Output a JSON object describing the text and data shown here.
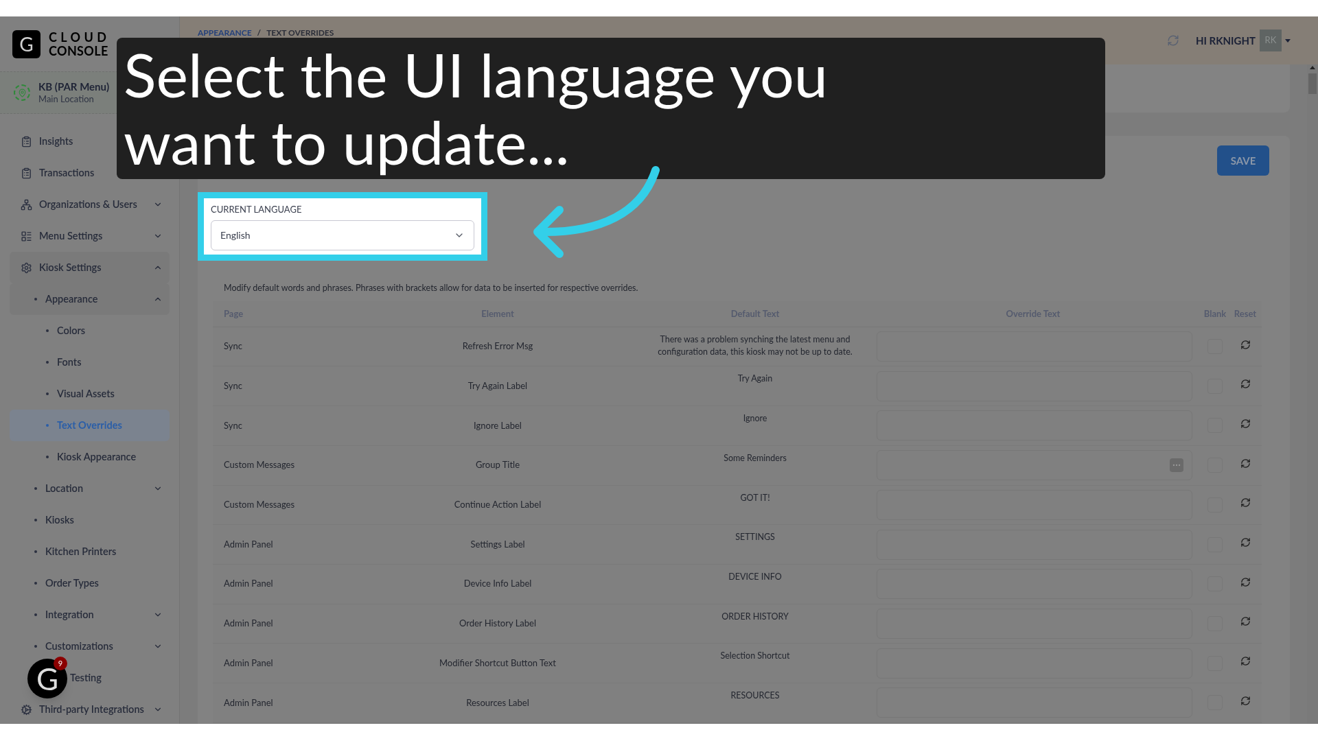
{
  "tutorial": {
    "caption": "Select the UI language you want to update..."
  },
  "brand": {
    "mark": "G",
    "line1": "CLOUD",
    "line2": "CONSOLE"
  },
  "location": {
    "name": "KB (PAR Menu)",
    "subtitle": "Main Location"
  },
  "sidebar": {
    "items": [
      {
        "label": "Insights",
        "kind": "link",
        "selected": false
      },
      {
        "label": "Transactions",
        "kind": "link",
        "selected": false
      },
      {
        "label": "Organizations & Users",
        "kind": "group",
        "expanded": false,
        "selected": false
      },
      {
        "label": "Menu Settings",
        "kind": "group",
        "expanded": false,
        "selected": false
      },
      {
        "label": "Kiosk Settings",
        "kind": "group",
        "expanded": true,
        "selected": false,
        "children": [
          {
            "label": "Appearance",
            "kind": "group",
            "expanded": true,
            "selected": false,
            "children": [
              {
                "label": "Colors",
                "kind": "link",
                "selected": false
              },
              {
                "label": "Fonts",
                "kind": "link",
                "selected": false
              },
              {
                "label": "Visual Assets",
                "kind": "link",
                "selected": false
              },
              {
                "label": "Text Overrides",
                "kind": "link",
                "selected": true
              },
              {
                "label": "Kiosk Appearance",
                "kind": "link",
                "selected": false
              }
            ]
          },
          {
            "label": "Location",
            "kind": "group",
            "expanded": false,
            "selected": false
          },
          {
            "label": "Kiosks",
            "kind": "link",
            "selected": false
          },
          {
            "label": "Kitchen Printers",
            "kind": "link",
            "selected": false
          },
          {
            "label": "Order Types",
            "kind": "link",
            "selected": false
          },
          {
            "label": "Integration",
            "kind": "group",
            "expanded": false,
            "selected": false
          },
          {
            "label": "Customizations",
            "kind": "group",
            "expanded": false,
            "selected": false
          },
          {
            "label": "Testing",
            "kind": "partial",
            "selected": false
          }
        ]
      },
      {
        "label": "Third-party Integrations",
        "kind": "group",
        "expanded": false,
        "selected": false
      }
    ]
  },
  "header": {
    "breadcrumb": [
      {
        "label": "APPEARANCE",
        "kind": "link"
      },
      {
        "label": "TEXT OVERRIDES",
        "kind": "current"
      }
    ],
    "separator": "/",
    "greeting": "HI RKNIGHT",
    "avatar": "RK"
  },
  "save_button": "SAVE",
  "language": {
    "label": "CURRENT LANGUAGE",
    "value": "English"
  },
  "description": "Modify default words and phrases. Phrases with brackets allow for data to be inserted for respective overrides.",
  "table": {
    "columns": [
      "Page",
      "Element",
      "Default Text",
      "Override Text",
      "Blank",
      "Reset"
    ],
    "rows": [
      {
        "page": "Sync",
        "element": "Refresh Error Msg",
        "default": "There was a problem synching the latest menu and configuration data, this kiosk may not be up to date.",
        "menu_button": false,
        "blank": false
      },
      {
        "page": "Sync",
        "element": "Try Again Label",
        "default": "Try Again",
        "menu_button": false,
        "blank": false
      },
      {
        "page": "Sync",
        "element": "Ignore Label",
        "default": "Ignore",
        "menu_button": false,
        "blank": false
      },
      {
        "page": "Custom Messages",
        "element": "Group Title",
        "default": "Some Reminders",
        "menu_button": true,
        "blank": false
      },
      {
        "page": "Custom Messages",
        "element": "Continue Action Label",
        "default": "GOT IT!",
        "menu_button": false,
        "blank": false
      },
      {
        "page": "Admin Panel",
        "element": "Settings Label",
        "default": "SETTINGS",
        "menu_button": false,
        "blank": false
      },
      {
        "page": "Admin Panel",
        "element": "Device Info Label",
        "default": "DEVICE INFO",
        "menu_button": false,
        "blank": false
      },
      {
        "page": "Admin Panel",
        "element": "Order History Label",
        "default": "ORDER HISTORY",
        "menu_button": false,
        "blank": false
      },
      {
        "page": "Admin Panel",
        "element": "Modifier Shortcut Button Text",
        "default": "Selection Shortcut",
        "menu_button": false,
        "blank": false
      },
      {
        "page": "Admin Panel",
        "element": "Resources Label",
        "default": "RESOURCES",
        "menu_button": false,
        "blank": false
      }
    ]
  },
  "chat_widget": {
    "mark": "G",
    "badge": "9"
  }
}
